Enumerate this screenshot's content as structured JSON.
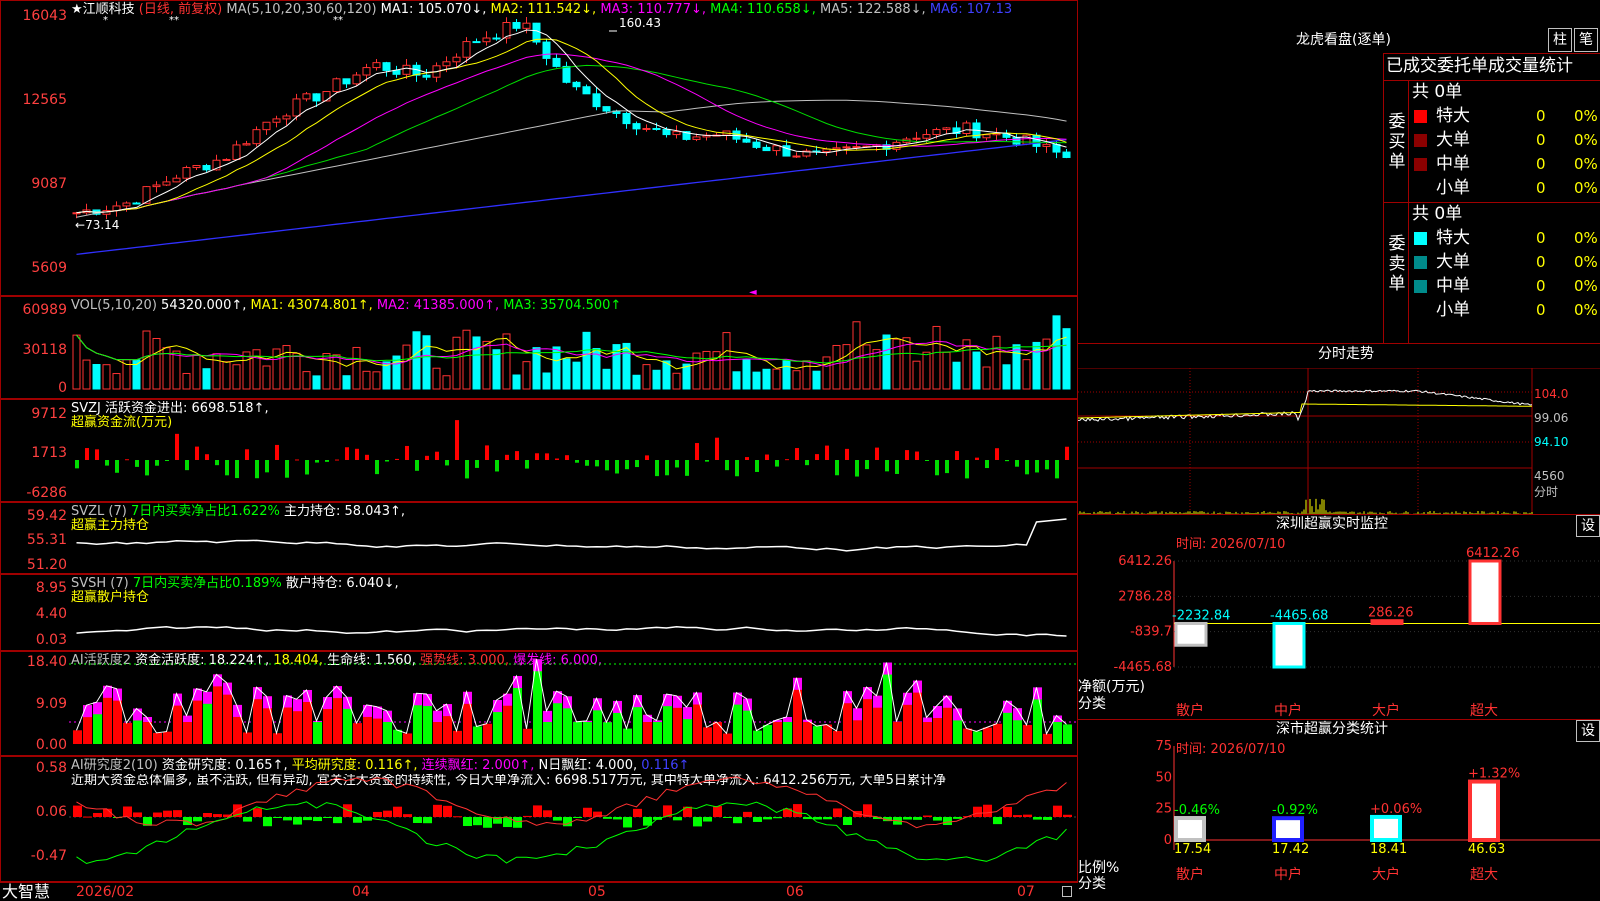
{
  "header": {
    "stock": "★江顺科技",
    "period": "(日线, 前复权)",
    "ma_label": "MA(5,10,20,30,60,120)",
    "ma1": "MA1: 105.070↓,",
    "ma2": "MA2: 111.542↓,",
    "ma3": "MA3: 110.777↓,",
    "ma4": "MA4: 110.658↓,",
    "ma5": "MA5: 122.588↓,",
    "ma6": "MA6: 107.13"
  },
  "price_axis": [
    "16043",
    "12565",
    "9087",
    "5609"
  ],
  "price_marks": {
    "high": "160.43",
    "low": "73.14"
  },
  "vol": {
    "title": "VOL(5,10,20)",
    "value": "54320.000↑,",
    "ma1": "MA1: 43074.801↑,",
    "ma2": "MA2: 41385.000↑,",
    "ma3": "MA3: 35704.500↑",
    "axis": [
      "60989",
      "30118",
      "0"
    ]
  },
  "svzj": {
    "title": "SVZJ  活跃资金进出: 6698.518↑,",
    "sub": "超赢资金流(万元)",
    "axis": [
      "9712",
      "1713",
      "-6286"
    ]
  },
  "svzl": {
    "title": "SVZL (7)",
    "pct": "7日内买卖净占比1.622%",
    "hold": "主力持仓: 58.043↑,",
    "sub": "超赢主力持仓",
    "axis": [
      "59.42",
      "55.31",
      "51.20"
    ]
  },
  "svsh": {
    "title": "SVSH (7)",
    "pct": "7日内买卖净占比0.189%",
    "hold": "散户持仓: 6.040↓,",
    "sub": "超赢散户持仓",
    "axis": [
      "8.95",
      "4.40",
      "0.03"
    ]
  },
  "ai1": {
    "title": "AI活跃度2",
    "a": "资金活跃度: 18.224↑,",
    "b": "18.404,",
    "c": "生命线: 1.560,",
    "d": "强势线: 3.000,",
    "e": "爆发线: 6.000,",
    "axis": [
      "18.40",
      "9.09",
      "0.00"
    ]
  },
  "ai2": {
    "title": "AI研究度2(10)",
    "a": "资金研究度: 0.165↑,",
    "b": "平均研究度: 0.116↑,",
    "c": "连续飘红: 2.000↑,",
    "d": "N日飘红: 4.000,",
    "e": "0.116↑",
    "desc": "近期大资金总体偏多, 虽不活跃, 但有异动, 宜关注大资金的持续性, 今日大单净流入: 6698.517万元, 其中特大单净流入: 6412.256万元, 大单5日累计净",
    "axis": [
      "0.58",
      "0.06",
      "-0.47"
    ]
  },
  "bottom": {
    "brand": "大智慧",
    "dates": [
      "2026/02",
      "04",
      "05",
      "06",
      "07"
    ]
  },
  "dragon": {
    "title": "龙虎看盘(逐单)",
    "btn1": "柱",
    "btn2": "笔",
    "tab": "已成交委托单成交量统计",
    "buy_label": "委买单",
    "sell_label": "委卖单",
    "buy_total": "共 0单",
    "sell_total": "共 0单",
    "rows": [
      "特大",
      "大单",
      "中单",
      "小单"
    ],
    "buy_values": [
      "0",
      "0",
      "0",
      "0"
    ],
    "buy_pcts": [
      "0%",
      "0%",
      "0%",
      "0%"
    ],
    "sell_values": [
      "0",
      "0",
      "0",
      "0"
    ],
    "sell_pcts": [
      "0%",
      "0%",
      "0%",
      "0%"
    ],
    "buy_colors": [
      "#ff0000",
      "#8b0000",
      "#8b0000",
      "#000000"
    ],
    "sell_colors": [
      "#00ffff",
      "#008b8b",
      "#008b8b",
      "#000000"
    ]
  },
  "intraday": {
    "title": "分时走势",
    "axis": [
      "104.0",
      "99.06",
      "94.10",
      "4560",
      "分时"
    ]
  },
  "monitor": {
    "title": "深圳超赢实时监控",
    "gear": "设",
    "time": "时间: 2026/07/10",
    "axis": [
      "6412.26",
      "2786.28",
      "-839.7",
      "-4465.68"
    ],
    "net_label": "净额(万元)",
    "cat_label": "分类",
    "categories": [
      "散户",
      "中户",
      "大户",
      "超大"
    ],
    "values": [
      -2232.84,
      -4465.68,
      286.26,
      6412.26
    ],
    "value_labels": [
      "-2232.84",
      "-4465.68",
      "286.26",
      "6412.26"
    ]
  },
  "stats": {
    "title": "深市超赢分类统计",
    "gear": "设",
    "time": "时间: 2026/07/10",
    "axis": [
      "75",
      "50",
      "25",
      "0"
    ],
    "ratio_label": "比例%",
    "cat_label": "分类",
    "categories": [
      "散户",
      "中户",
      "大户",
      "超大"
    ],
    "pct_labels": [
      "-0.46%",
      "-0.92%",
      "+0.06%",
      "+1.32%"
    ],
    "values": [
      17.54,
      17.42,
      18.41,
      46.63
    ],
    "value_labels": [
      "17.54",
      "17.42",
      "18.41",
      "46.63"
    ]
  },
  "colors": {
    "up": "#ff3232",
    "down": "#00ffff",
    "border": "#a00000",
    "yellow": "#ffff00",
    "magenta": "#ff00ff",
    "green": "#00ff00"
  }
}
